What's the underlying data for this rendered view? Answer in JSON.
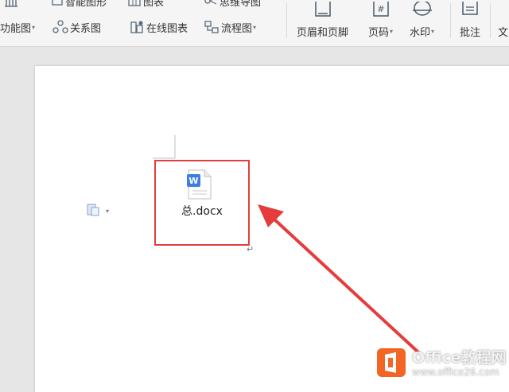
{
  "ribbon": {
    "row1": {
      "func_chart_partial": "",
      "smart_shape": "智能图形",
      "chart": "图表",
      "mind_map": "思维导图"
    },
    "row2": {
      "func_chart": "功能图",
      "relation_chart": "关系图",
      "online_chart": "在线图表",
      "flowchart": "流程图"
    },
    "header_footer": "页眉和页脚",
    "page_number": "页码",
    "watermark": "水印",
    "comment": "批注",
    "text_partial": "文"
  },
  "document": {
    "attachment_filename": "总.docx",
    "attachment_icon_letter": "W",
    "paragraph_mark": "↵"
  },
  "site_watermark": {
    "brand": "Office教程网",
    "url": "www.office26.com"
  },
  "colors": {
    "highlight_box": "#e53c3c",
    "arrow": "#e53c3c",
    "file_icon_blue": "#3d7ee5",
    "logo_orange": "#f26522"
  },
  "icons": {
    "attachment": "word-document-icon",
    "paste_options": "paste-options-icon",
    "logo": "office-logo-icon"
  }
}
